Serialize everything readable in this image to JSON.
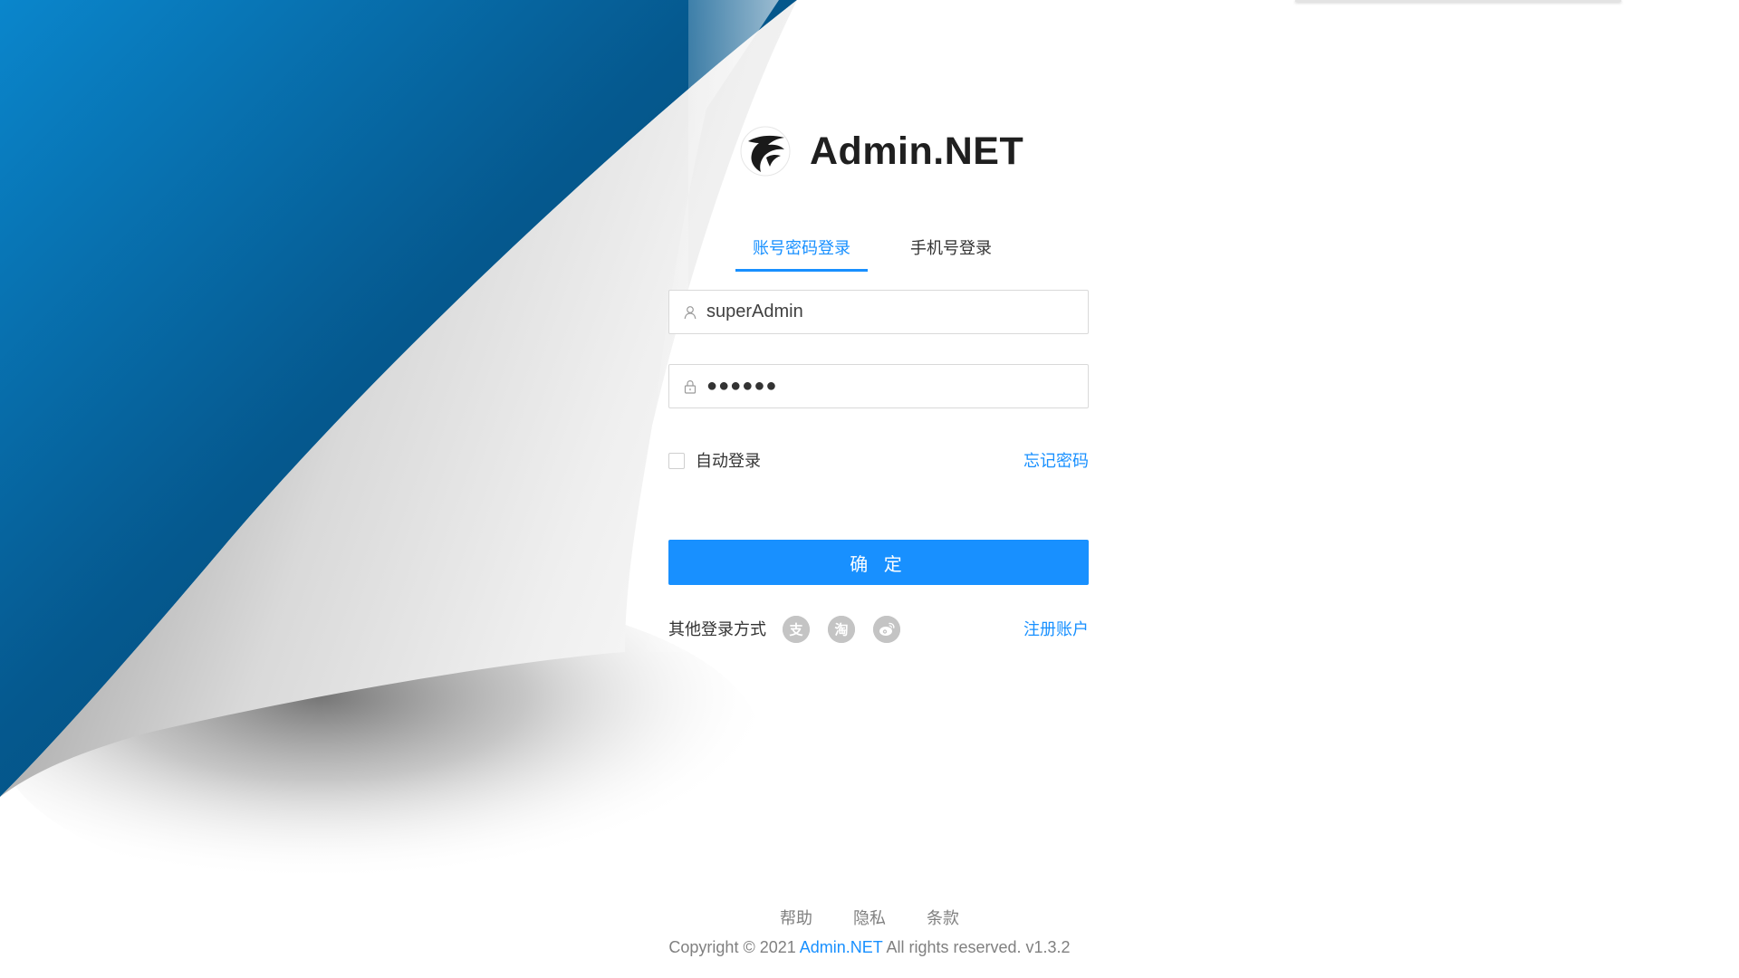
{
  "app": {
    "title": "Admin.NET"
  },
  "tabs": [
    {
      "label": "账号密码登录",
      "active": true
    },
    {
      "label": "手机号登录",
      "active": false
    }
  ],
  "form": {
    "username_value": "superAdmin",
    "password_masked": "●●●●●●",
    "remember_label": "自动登录",
    "remember_checked": false,
    "forgot_label": "忘记密码",
    "submit_label": "确 定"
  },
  "other_login": {
    "label": "其他登录方式",
    "providers": [
      {
        "icon": "alipay-icon",
        "glyph": "支"
      },
      {
        "icon": "taobao-icon",
        "glyph": "淘"
      },
      {
        "icon": "weibo-icon",
        "glyph": "微"
      }
    ],
    "register_label": "注册账户"
  },
  "footer": {
    "links": [
      "帮助",
      "隐私",
      "条款"
    ],
    "copyright_prefix": "Copyright © 2021 ",
    "copyright_brand": "Admin.NET",
    "copyright_suffix": " All rights reserved. v1.3.2"
  },
  "colors": {
    "primary": "#1890ff",
    "curl_blue_light": "#0a7fc4",
    "curl_blue_dark": "#004a74",
    "text_muted": "#808080"
  }
}
